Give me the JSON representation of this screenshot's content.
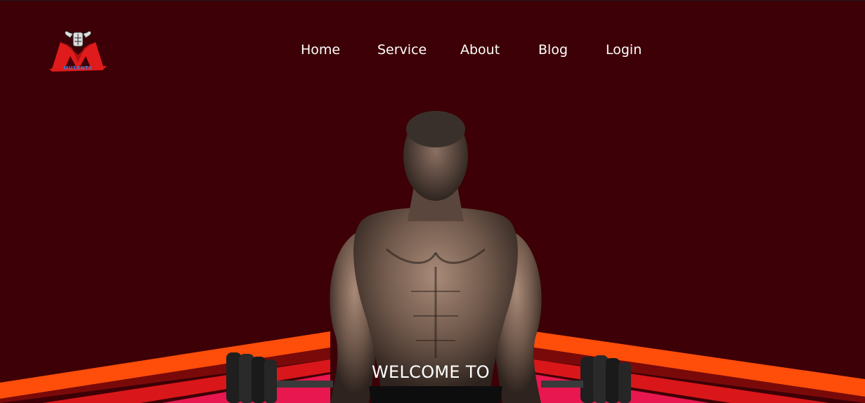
{
  "logo": {
    "text": "MUTANTS",
    "icon": "flexing-arms-w-logo"
  },
  "nav": {
    "items": [
      {
        "label": "Home"
      },
      {
        "label": "Service"
      },
      {
        "label": "About"
      },
      {
        "label": "Blog"
      },
      {
        "label": "Login"
      }
    ]
  },
  "hero": {
    "heading": "WELCOME TO",
    "image": "bodybuilder-with-dumbbells"
  },
  "colors": {
    "background": "#3d0006",
    "stripe_orange": "#ff4d0a",
    "stripe_red": "#d9171a",
    "stripe_pink": "#e8174f",
    "text": "#ffffff",
    "logo_red": "#e01b1b"
  }
}
